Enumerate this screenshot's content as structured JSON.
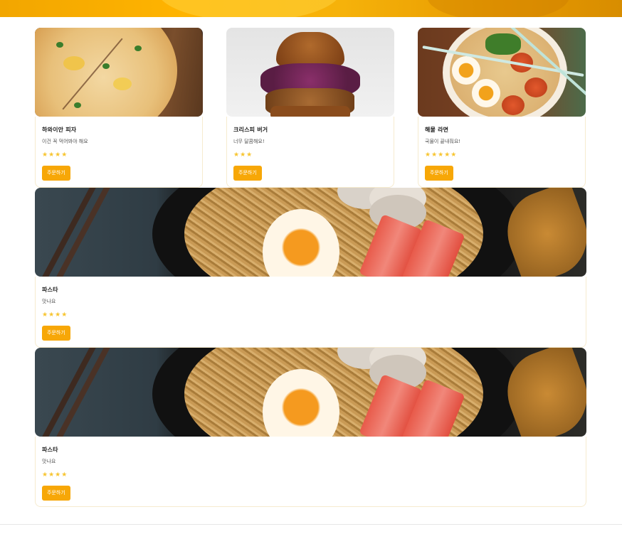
{
  "cards": [
    {
      "title": "하와이안 피자",
      "description": "이건 꼭 먹어봐야 해요",
      "stars": "★★★★",
      "rating": 4,
      "button": "주문하기",
      "image": "pizza-photo"
    },
    {
      "title": "크리스피 버거",
      "description": "너무 달콤해요!",
      "stars": "★★★",
      "rating": 3,
      "button": "주문하기",
      "image": "burger-photo"
    },
    {
      "title": "해물 라면",
      "description": "국물이 끝내줘요!",
      "stars": "★★★★★",
      "rating": 5,
      "button": "주문하기",
      "image": "ramen-photo"
    },
    {
      "title": "파스타",
      "description": "맛나요",
      "stars": "★★★★",
      "rating": 4,
      "button": "주문하기",
      "image": "noodle-photo"
    },
    {
      "title": "파스타",
      "description": "맛나요",
      "stars": "★★★★",
      "rating": 4,
      "button": "주문하기",
      "image": "noodle-photo"
    }
  ],
  "colors": {
    "accent": "#f7a707",
    "star": "#f7c531",
    "card_border": "#f6ebcf",
    "banner": "#ffb400"
  }
}
